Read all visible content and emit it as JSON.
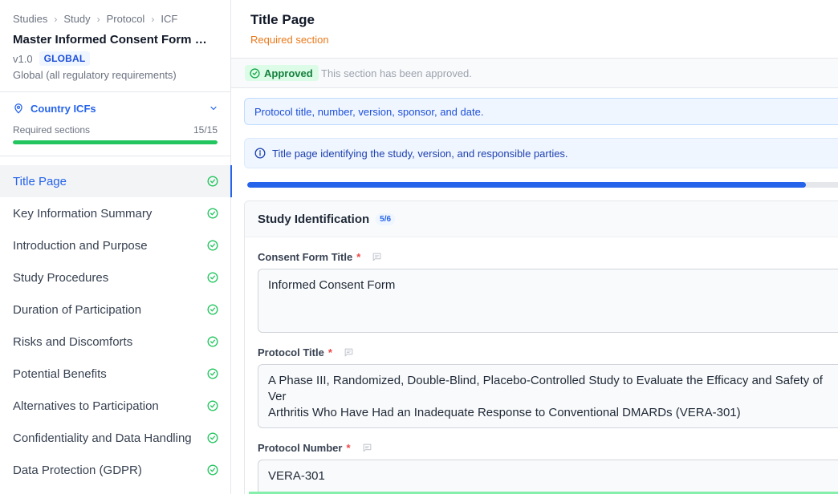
{
  "breadcrumb": [
    "Studies",
    "Study",
    "Protocol",
    "ICF"
  ],
  "document": {
    "title": "Master Informed Consent Form — ...",
    "version": "v1.0",
    "scope_badge": "GLOBAL",
    "scope_text": "Global (all regulatory requirements)"
  },
  "country_icfs": {
    "label": "Country ICFs"
  },
  "required_sections": {
    "label": "Required sections",
    "count": "15/15",
    "progress": 1.0
  },
  "sections": [
    {
      "label": "Title Page",
      "active": true,
      "complete": true
    },
    {
      "label": "Key Information Summary",
      "active": false,
      "complete": true
    },
    {
      "label": "Introduction and Purpose",
      "active": false,
      "complete": true
    },
    {
      "label": "Study Procedures",
      "active": false,
      "complete": true
    },
    {
      "label": "Duration of Participation",
      "active": false,
      "complete": true
    },
    {
      "label": "Risks and Discomforts",
      "active": false,
      "complete": true
    },
    {
      "label": "Potential Benefits",
      "active": false,
      "complete": true
    },
    {
      "label": "Alternatives to Participation",
      "active": false,
      "complete": true
    },
    {
      "label": "Confidentiality and Data Handling",
      "active": false,
      "complete": true
    },
    {
      "label": "Data Protection (GDPR)",
      "active": false,
      "complete": true
    }
  ],
  "main": {
    "title": "Title Page",
    "subtitle": "Required section",
    "status": {
      "badge": "Approved",
      "message": "This section has been approved."
    },
    "hint": "Protocol title, number, version, sponsor, and date.",
    "info": "Title page identifying the study, version, and responsible parties.",
    "progress": 0.94,
    "card": {
      "title": "Study Identification",
      "count": "5/6",
      "fields": [
        {
          "label": "Consent Form Title",
          "required": "*",
          "value": "Informed Consent Form"
        },
        {
          "label": "Protocol Title",
          "required": "*",
          "value": "A Phase III, Randomized, Double-Blind, Placebo-Controlled Study to Evaluate the Efficacy and Safety of Ver\nArthritis Who Have Had an Inadequate Response to Conventional DMARDs (VERA-301)"
        },
        {
          "label": "Protocol Number",
          "required": "*",
          "value": "VERA-301"
        }
      ]
    }
  },
  "colors": {
    "accent": "#2563eb",
    "success": "#22c55e",
    "warning": "#ea7a1c",
    "required": "#ef4444"
  },
  "icons": {
    "check": "check-circle-icon",
    "pin": "map-pin-icon",
    "chevron": "chevron-down-icon",
    "info": "info-circle-icon",
    "comment": "comment-icon"
  }
}
